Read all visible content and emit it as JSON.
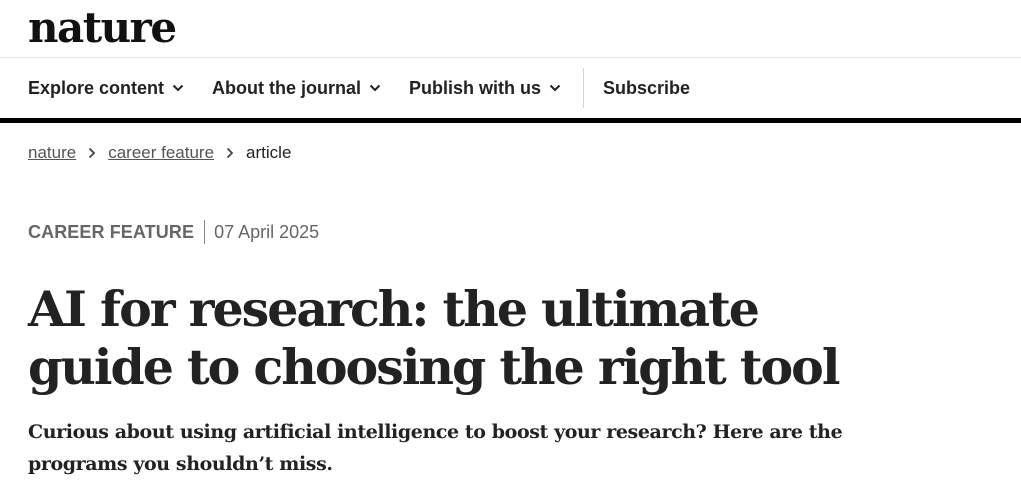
{
  "site": {
    "logo_text": "nature"
  },
  "nav": {
    "items": [
      {
        "label": "Explore content",
        "icon": "chevron-down-icon"
      },
      {
        "label": "About the journal",
        "icon": "chevron-down-icon"
      },
      {
        "label": "Publish with us",
        "icon": "chevron-down-icon"
      }
    ],
    "subscribe_label": "Subscribe"
  },
  "breadcrumb": {
    "items": [
      {
        "label": "nature"
      },
      {
        "label": "career feature"
      }
    ],
    "current": "article"
  },
  "article": {
    "type": "CAREER FEATURE",
    "date": "07 April 2025",
    "title": "AI for research: the ultimate guide to choosing the right tool",
    "standfirst": "Curious about using artificial intelligence to boost your research? Here are the programs you shouldn’t miss."
  },
  "colors": {
    "text": "#222222",
    "muted": "#666666",
    "rule": "#000000"
  }
}
